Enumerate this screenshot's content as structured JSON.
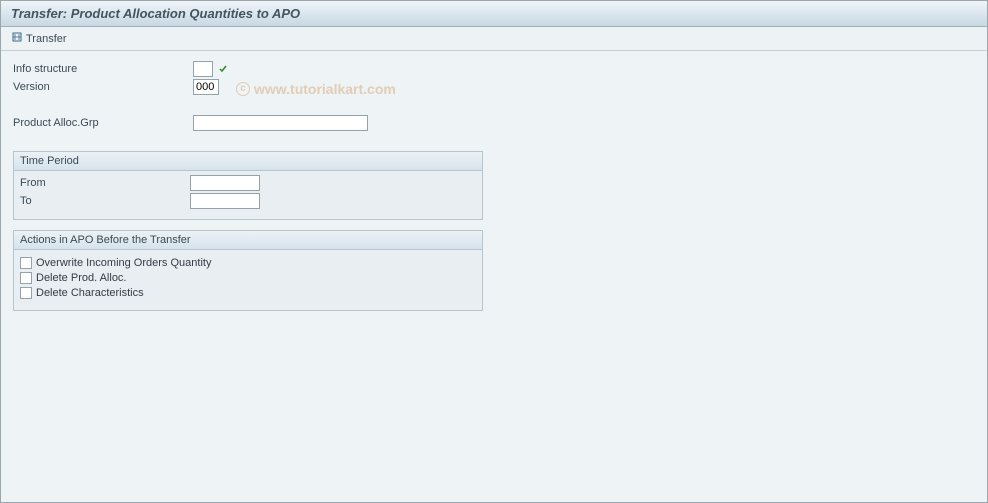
{
  "title": "Transfer: Product Allocation Quantities to APO",
  "toolbar": {
    "transfer_label": "Transfer"
  },
  "fields": {
    "info_structure_label": "Info structure",
    "info_structure_value": "",
    "version_label": "Version",
    "version_value": "000",
    "prod_alloc_grp_label": "Product Alloc.Grp",
    "prod_alloc_grp_value": ""
  },
  "time_period": {
    "heading": "Time Period",
    "from_label": "From",
    "from_value": "",
    "to_label": "To",
    "to_value": ""
  },
  "actions": {
    "heading": "Actions in APO Before the Transfer",
    "overwrite_label": "Overwrite Incoming Orders Quantity",
    "overwrite_checked": false,
    "delete_prod_alloc_label": "Delete Prod. Alloc.",
    "delete_prod_alloc_checked": false,
    "delete_characteristics_label": "Delete Characteristics",
    "delete_characteristics_checked": false
  },
  "watermark": "www.tutorialkart.com"
}
